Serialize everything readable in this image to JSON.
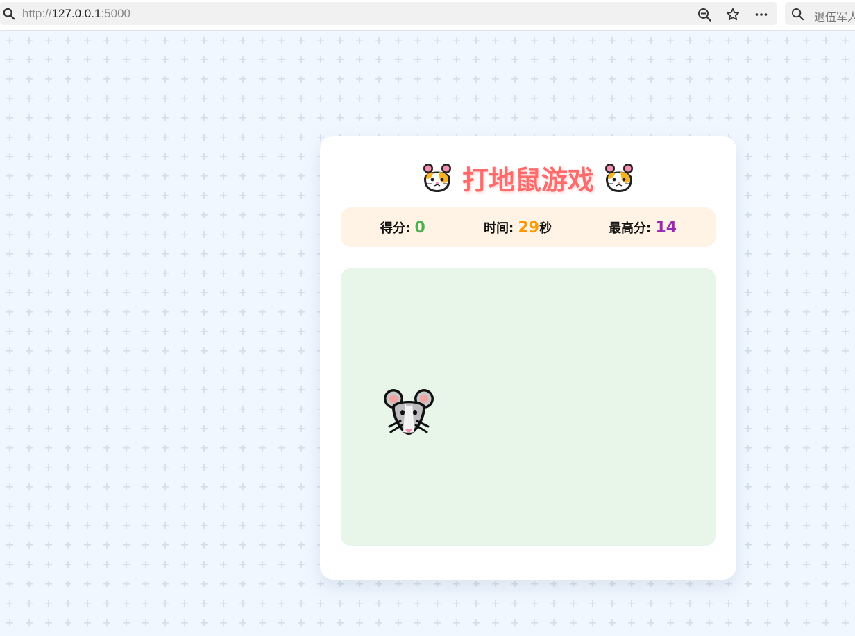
{
  "browser": {
    "url_prefix": "http://",
    "url_host": "127.0.0.1",
    "url_port": ":5000",
    "search_text": "退伍军人"
  },
  "game": {
    "title": "打地鼠游戏",
    "title_icon": "hamster-face-icon",
    "target_icon": "mouse-face-icon",
    "stats": {
      "score_label": "得分: ",
      "score_value": "0",
      "time_label": "时间: ",
      "time_value": "29",
      "time_unit": "秒",
      "best_label": "最高分: ",
      "best_value": "14"
    },
    "colors": {
      "title": "#ff6b6b",
      "score": "#4caf50",
      "time": "#ff9800",
      "best": "#9c27b0",
      "stats_bg": "#fff3e6",
      "field_bg": "#e8f5e9",
      "page_bg": "#f0f7ff"
    }
  }
}
